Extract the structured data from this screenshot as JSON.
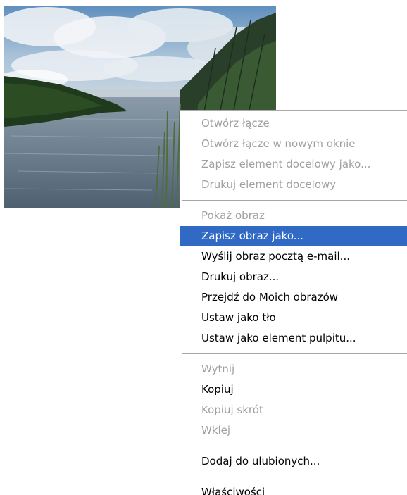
{
  "context_menu": {
    "groups": [
      {
        "items": [
          {
            "label": "Otwórz łącze",
            "enabled": false
          },
          {
            "label": "Otwórz łącze w nowym oknie",
            "enabled": false
          },
          {
            "label": "Zapisz element docelowy jako...",
            "enabled": false
          },
          {
            "label": "Drukuj element docelowy",
            "enabled": false
          }
        ]
      },
      {
        "items": [
          {
            "label": "Pokaż obraz",
            "enabled": false
          },
          {
            "label": "Zapisz obraz jako...",
            "enabled": true,
            "selected": true
          },
          {
            "label": "Wyślij obraz pocztą e-mail...",
            "enabled": true
          },
          {
            "label": "Drukuj obraz...",
            "enabled": true
          },
          {
            "label": "Przejdź do Moich obrazów",
            "enabled": true
          },
          {
            "label": "Ustaw jako tło",
            "enabled": true
          },
          {
            "label": "Ustaw jako element pulpitu...",
            "enabled": true
          }
        ]
      },
      {
        "items": [
          {
            "label": "Wytnij",
            "enabled": false
          },
          {
            "label": "Kopiuj",
            "enabled": true
          },
          {
            "label": "Kopiuj skrót",
            "enabled": false
          },
          {
            "label": "Wklej",
            "enabled": false
          }
        ]
      },
      {
        "items": [
          {
            "label": "Dodaj do ulubionych...",
            "enabled": true
          }
        ]
      },
      {
        "items": [
          {
            "label": "Właściwości",
            "enabled": true
          }
        ]
      }
    ]
  },
  "colors": {
    "highlight": "#316ac5",
    "disabled_text": "#a0a0a0",
    "separator": "#a6a6a6"
  }
}
